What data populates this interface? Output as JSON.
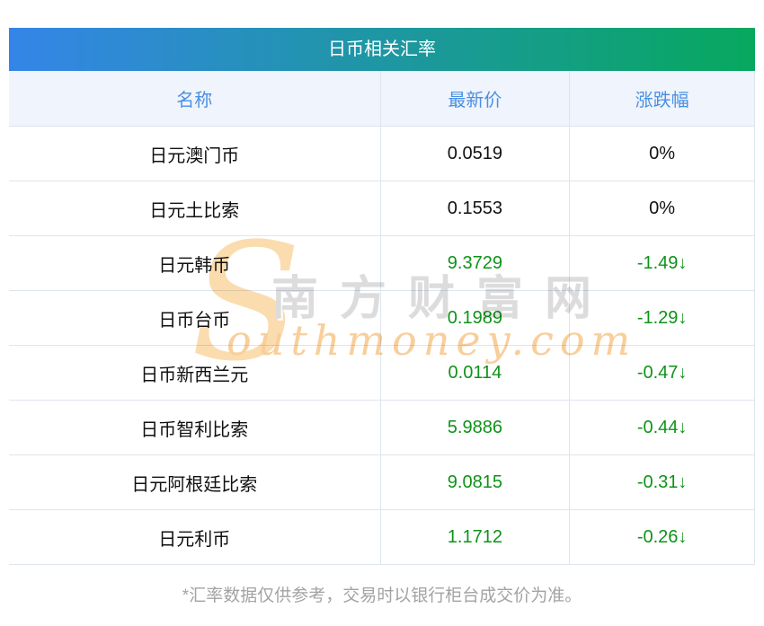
{
  "page": {
    "title": "日币相关汇率",
    "footnote": "*汇率数据仅供参考，交易时以银行柜台成交价为准。"
  },
  "table": {
    "columns": [
      "名称",
      "最新价",
      "涨跌幅"
    ],
    "rows": [
      {
        "name": "日元澳门币",
        "price": "0.0519",
        "change": "0%",
        "trend": "flat"
      },
      {
        "name": "日元土比索",
        "price": "0.1553",
        "change": "0%",
        "trend": "flat"
      },
      {
        "name": "日元韩币",
        "price": "9.3729",
        "change": "-1.49↓",
        "trend": "down"
      },
      {
        "name": "日币台币",
        "price": "0.1989",
        "change": "-1.29↓",
        "trend": "down"
      },
      {
        "name": "日币新西兰元",
        "price": "0.0114",
        "change": "-0.47↓",
        "trend": "down"
      },
      {
        "name": "日币智利比索",
        "price": "5.9886",
        "change": "-0.44↓",
        "trend": "down"
      },
      {
        "name": "日元阿根廷比索",
        "price": "9.0815",
        "change": "-0.31↓",
        "trend": "down"
      },
      {
        "name": "日元利币",
        "price": "1.1712",
        "change": "-0.26↓",
        "trend": "down"
      }
    ]
  },
  "chart_data": {
    "type": "table",
    "title": "日币相关汇率",
    "columns": [
      "名称",
      "最新价",
      "涨跌幅"
    ],
    "rows": [
      [
        "日元澳门币",
        0.0519,
        "0%"
      ],
      [
        "日元土比索",
        0.1553,
        "0%"
      ],
      [
        "日元韩币",
        9.3729,
        "-1.49↓"
      ],
      [
        "日币台币",
        0.1989,
        "-1.29↓"
      ],
      [
        "日币新西兰元",
        0.0114,
        "-0.47↓"
      ],
      [
        "日币智利比索",
        5.9886,
        "-0.44↓"
      ],
      [
        "日元阿根廷比索",
        9.0815,
        "-0.31↓"
      ],
      [
        "日元利币",
        1.1712,
        "-0.26↓"
      ]
    ],
    "notes": "*汇率数据仅供参考，交易时以银行柜台成交价为准。"
  },
  "watermark": {
    "initial": "S",
    "cjk": "南方财富网",
    "latin": "outhmoney.com"
  },
  "colors": {
    "gradient_start": "#3585e8",
    "gradient_end": "#07a85e",
    "header_bg": "#f0f4fc",
    "header_text": "#4a90e2",
    "down_green": "#0e9318",
    "flat_black": "#111111",
    "divider": "#dfe5ee",
    "footnote_gray": "#a3a3a3",
    "watermark_orange": "#f8cf9b",
    "watermark_orange_light": "#fbdcae",
    "watermark_gray": "#dcdcdc"
  }
}
